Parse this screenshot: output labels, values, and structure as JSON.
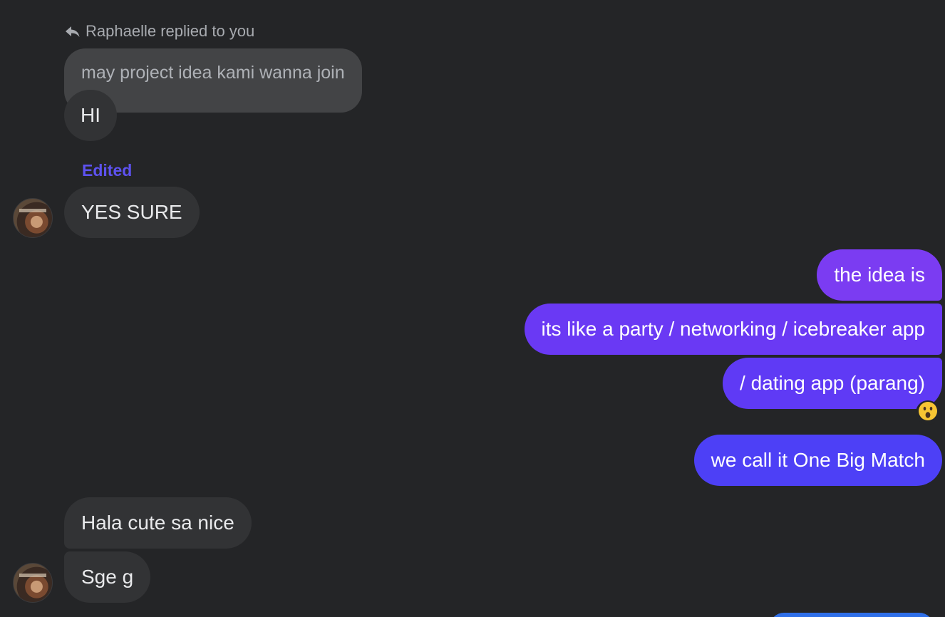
{
  "reply": {
    "header": "Raphaelle replied to you",
    "icon": "reply-arrow-icon",
    "quoted_text": "may project idea kami wanna join",
    "reply_text": "HI"
  },
  "edited_label": "Edited",
  "incoming_1": {
    "text": "YES SURE",
    "avatar": "profile-photo"
  },
  "outgoing": [
    {
      "text": "the idea is",
      "color": "#7b3cf2"
    },
    {
      "text": "its like a party / networking / icebreaker app",
      "color": "#6a39f4"
    },
    {
      "text": "/ dating app (parang)",
      "color": "#5f3af5"
    },
    {
      "text": "we call it One Big Match",
      "color": "#4d40f6"
    }
  ],
  "reaction": {
    "emoji": "😮",
    "icon": "surprised-face-icon"
  },
  "incoming_2": [
    {
      "text": "Hala cute sa nice"
    },
    {
      "text": "Sge g"
    }
  ],
  "colors": {
    "background": "#242527",
    "incoming_bubble": "#323335",
    "edited": "#5e52f0",
    "next_bubble": "#2f6fe8"
  }
}
